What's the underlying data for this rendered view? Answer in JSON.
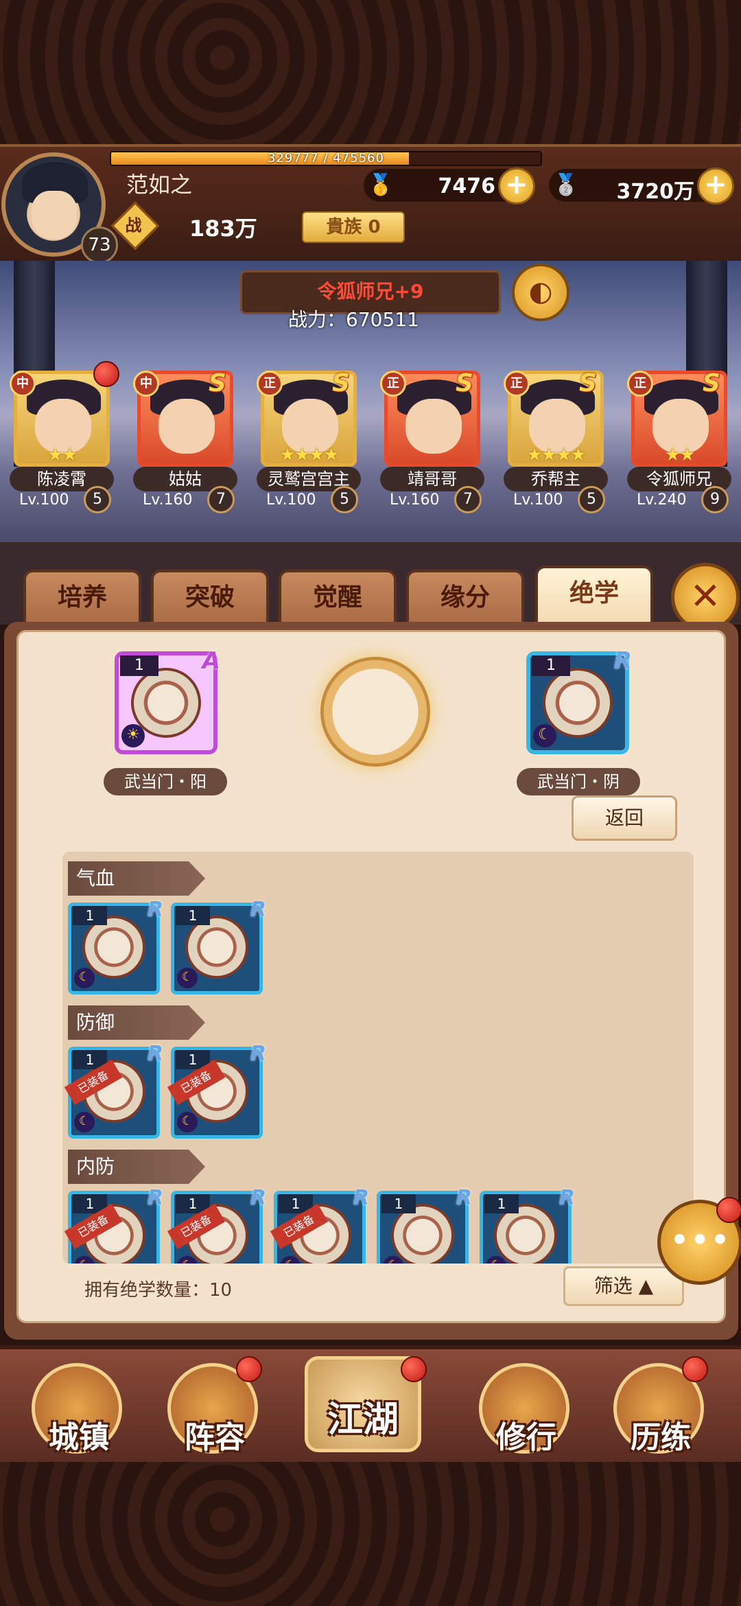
{
  "player": {
    "name": "范如之",
    "level": "73",
    "exp_text": "329777 / 475560",
    "exp_fraction": 0.6935,
    "power": "183万",
    "power_icon_char": "战",
    "noble": "貴族 0"
  },
  "currency": {
    "gold": "7476",
    "silver": "3720万",
    "plus": "+"
  },
  "scene": {
    "hero_title": "令狐师兄+9",
    "combat_power": "战力：670511"
  },
  "heroes": [
    {
      "name": "陈凌霄",
      "faction": "中",
      "rarity": "",
      "stars": "★★",
      "level": "Lv.100",
      "count": "5"
    },
    {
      "name": "姑姑",
      "faction": "中",
      "rarity": "S",
      "stars": "",
      "level": "Lv.160",
      "count": "7"
    },
    {
      "name": "灵鹫宫宫主",
      "faction": "正",
      "rarity": "S",
      "stars": "★★★★",
      "level": "Lv.100",
      "count": "5"
    },
    {
      "name": "靖哥哥",
      "faction": "正",
      "rarity": "S",
      "stars": "",
      "level": "Lv.160",
      "count": "7"
    },
    {
      "name": "乔帮主",
      "faction": "正",
      "rarity": "S",
      "stars": "★★★★",
      "level": "Lv.100",
      "count": "5"
    },
    {
      "name": "令狐师兄",
      "faction": "正",
      "rarity": "S",
      "stars": "★★",
      "level": "Lv.240",
      "count": "9"
    }
  ],
  "tabs": [
    "培养",
    "突破",
    "觉醒",
    "缘分",
    "绝学"
  ],
  "active_tab": "绝学",
  "equipped_slots": {
    "left": {
      "label": "武当门・阳",
      "count": "1",
      "rank": "A",
      "symbol": "☀"
    },
    "right": {
      "label": "武当门・阴",
      "count": "1",
      "rank": "R",
      "symbol": "☾"
    }
  },
  "back_label": "返回",
  "categories": [
    {
      "title": "气血",
      "cards": [
        {
          "count": "1",
          "rank": "R",
          "equipped": ""
        },
        {
          "count": "1",
          "rank": "R",
          "equipped": ""
        }
      ]
    },
    {
      "title": "防御",
      "cards": [
        {
          "count": "1",
          "rank": "R",
          "equipped": "已装备"
        },
        {
          "count": "1",
          "rank": "R",
          "equipped": "已装备"
        }
      ]
    },
    {
      "title": "内防",
      "cards": [
        {
          "count": "1",
          "rank": "R",
          "equipped": "已装备"
        },
        {
          "count": "1",
          "rank": "R",
          "equipped": "已装备"
        },
        {
          "count": "1",
          "rank": "R",
          "equipped": "已装备"
        },
        {
          "count": "1",
          "rank": "R",
          "equipped": ""
        },
        {
          "count": "1",
          "rank": "R",
          "equipped": ""
        }
      ]
    }
  ],
  "skill_count_text": "拥有绝学数量：10",
  "filter_label": "筛选 ▲",
  "nav": [
    "城镇",
    "阵容",
    "江湖",
    "修行",
    "历练"
  ],
  "colors": {
    "accent": "#e6ae3c",
    "panel": "#f3e3cc",
    "notification": "#c31a12"
  }
}
